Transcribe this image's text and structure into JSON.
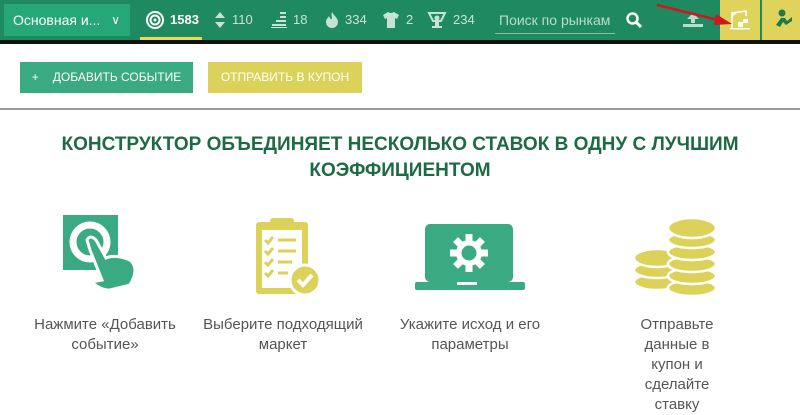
{
  "header": {
    "dropdown_label": "Основная и...",
    "stats": [
      {
        "icon": "target-icon",
        "value": "1583",
        "active": true
      },
      {
        "icon": "up-down-icon",
        "value": "110"
      },
      {
        "icon": "bars-icon",
        "value": "18"
      },
      {
        "icon": "fire-icon",
        "value": "334"
      },
      {
        "icon": "shirt-icon",
        "value": "2"
      },
      {
        "icon": "trophy-icon",
        "value": "234"
      }
    ],
    "search_placeholder": "Поиск по рынкам"
  },
  "actions": {
    "add_event": "ДОБАВИТЬ СОБЫТИЕ",
    "add_plus": "+",
    "send_coupon": "ОТПРАВИТЬ В КУПОН"
  },
  "heading": "КОНСТРУКТОР ОБЪЕДИНЯЕТ НЕСКОЛЬКО СТАВОК В ОДНУ С ЛУЧШИМ КОЭФФИЦИЕНТОМ",
  "steps": [
    {
      "icon": "tap-button-icon",
      "text": "Нажмите «Добавить событие»"
    },
    {
      "icon": "clipboard-check-icon",
      "text": "Выберите подходящий маркет"
    },
    {
      "icon": "laptop-gear-icon",
      "text": "Укажите исход и его параметры"
    },
    {
      "icon": "coins-icon",
      "text": "Отправьте данные в купон и сделайте ставку"
    }
  ],
  "colors": {
    "header": "#1f8a5f",
    "green": "#3aaa82",
    "yellow": "#dcd25a",
    "heading": "#1e6a44",
    "annotation_arrow": "#d0161e"
  }
}
